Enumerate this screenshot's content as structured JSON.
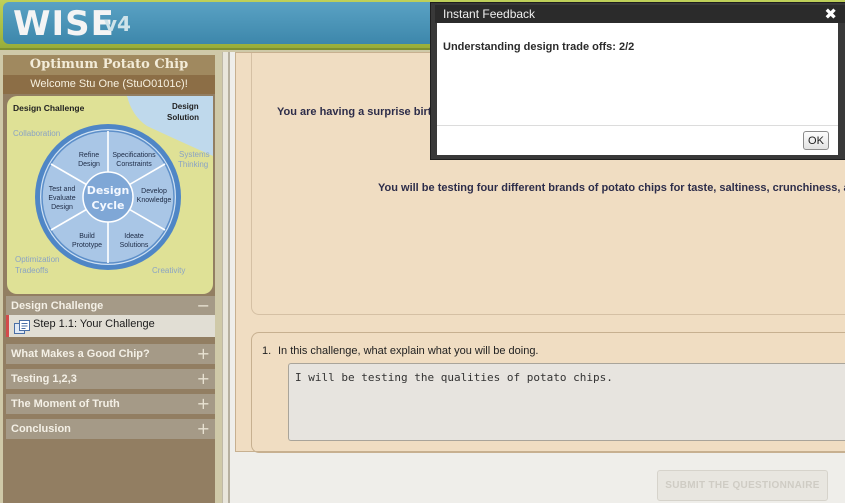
{
  "app": {
    "logo": "WISE",
    "version": "v4"
  },
  "sidebar": {
    "project_title": "Optimum Potato Chip",
    "welcome": "Welcome Stu One (StuO0101c)!",
    "design_cycle": {
      "center": [
        "Design",
        "Cycle"
      ],
      "corner_labels": {
        "design_challenge": "Design Challenge",
        "design_solution": [
          "Design",
          "Solution"
        ],
        "collaboration": "Collaboration",
        "systems_thinking": [
          "Systems",
          "Thinking"
        ],
        "optimization_tradeoffs": [
          "Optimization",
          "Tradeoffs"
        ],
        "creativity": "Creativity"
      },
      "segments": {
        "refine": [
          "Refine",
          "Design"
        ],
        "specs": [
          "Specifications",
          "Constraints"
        ],
        "develop": [
          "Develop",
          "Knowledge"
        ],
        "ideate": [
          "Ideate",
          "Solutions"
        ],
        "build": [
          "Build",
          "Prototype"
        ],
        "test": [
          "Test and",
          "Evaluate",
          "Design"
        ]
      }
    },
    "sections": [
      {
        "label": "Design Challenge",
        "toggle": "−"
      },
      {
        "label": "What Makes a Good Chip?",
        "toggle": "+"
      },
      {
        "label": "Testing 1,2,3",
        "toggle": "+"
      },
      {
        "label": "The Moment of Truth",
        "toggle": "+"
      },
      {
        "label": "Conclusion",
        "toggle": "+"
      }
    ],
    "current_step": {
      "label": "Step 1.1: Your Challenge",
      "icon": "questionnaire-icon"
    }
  },
  "main": {
    "intro_line1": "You are having a surprise birthd",
    "intro_line2": "You will be testing four different brands of potato chips for taste, saltiness, crunchiness, and grea",
    "question": {
      "number": "1.",
      "text": "In this challenge, what explain what you will be doing.",
      "answer": "I will be testing the qualities of potato chips."
    },
    "submit_label": "SUBMIT THE QUESTIONNAIRE"
  },
  "dialog": {
    "title": "Instant Feedback",
    "close_icon": "close-icon",
    "message": "Understanding design trade offs: 2/2",
    "ok_label": "OK"
  },
  "colors": {
    "header_green": "#a9be44",
    "logo_blue": "#3d87ab",
    "sidebar_brown": "#927e62",
    "content_tan": "#f0ddc2",
    "step_marker": "#d34b4b",
    "dialog_dark": "#393939"
  }
}
